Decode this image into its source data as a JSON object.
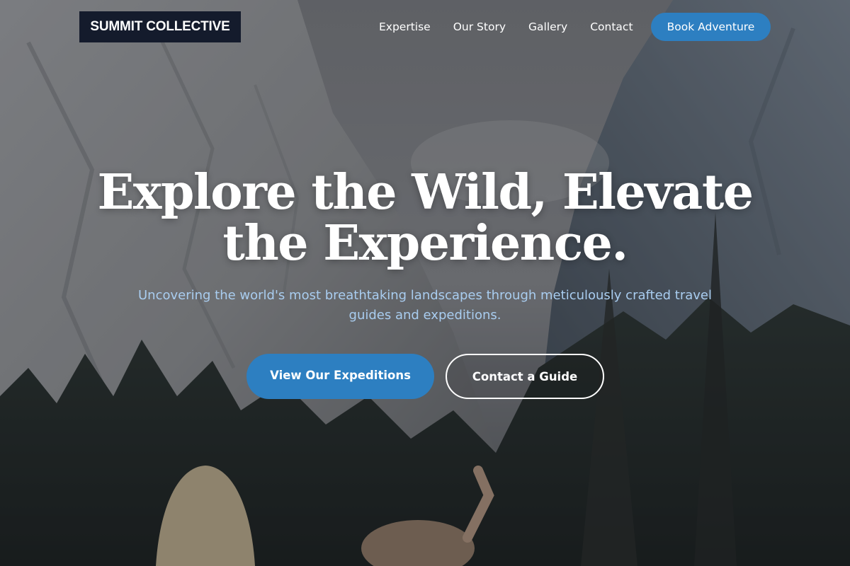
{
  "brand": {
    "name": "SUMMIT COLLECTIVE"
  },
  "nav": {
    "links": [
      "Expertise",
      "Our Story",
      "Gallery",
      "Contact"
    ],
    "cta_label": "Book Adventure"
  },
  "hero": {
    "headline": "Explore the Wild, Elevate the Experience.",
    "subtitle": "Uncovering the world's most breathtaking landscapes through meticulously crafted travel guides and expeditions.",
    "primary_cta": "View Our Expeditions",
    "secondary_cta": "Contact a Guide",
    "background_image": "mountain-valley-photo"
  },
  "colors": {
    "accent": "#2d7fc1",
    "logo_bg": "#141b2c",
    "subtitle": "#a9cdf0"
  }
}
